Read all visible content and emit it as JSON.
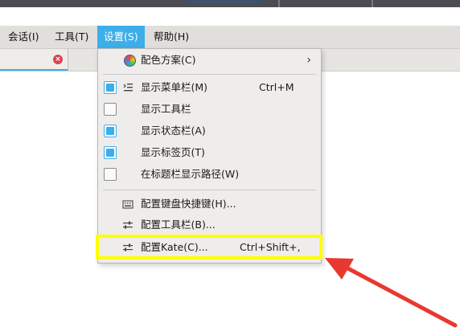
{
  "menubar": {
    "items": [
      {
        "label": "会话(I)"
      },
      {
        "label": "工具(T)"
      },
      {
        "label": "设置(S)"
      },
      {
        "label": "帮助(H)"
      }
    ]
  },
  "settings_menu": {
    "color_scheme": {
      "label": "配色方案(C)"
    },
    "show_menubar": {
      "label": "显示菜单栏(M)",
      "shortcut": "Ctrl+M",
      "checked": true
    },
    "show_toolbar": {
      "label": "显示工具栏",
      "checked": false
    },
    "show_statusbar": {
      "label": "显示状态栏(A)",
      "checked": true
    },
    "show_tabs": {
      "label": "显示标签页(T)",
      "checked": true
    },
    "show_path_in_title": {
      "label": "在标题栏显示路径(W)",
      "checked": false
    },
    "configure_shortcuts": {
      "label": "配置键盘快捷键(H)..."
    },
    "configure_toolbars": {
      "label": "配置工具栏(B)..."
    },
    "configure_kate": {
      "label": "配置Kate(C)...",
      "shortcut": "Ctrl+Shift+,"
    }
  },
  "icons": {
    "color_scheme": "color-wheel-icon",
    "menubar": "menu-list-icon",
    "shortcuts": "keyboard-icon",
    "toolbars": "sliders-icon",
    "kate": "sliders-icon",
    "tab_close": "close-icon"
  },
  "colors": {
    "accent": "#3daee9",
    "highlight": "#ffff00",
    "annotation_arrow": "#e8382f",
    "tab_close": "#da4453"
  }
}
